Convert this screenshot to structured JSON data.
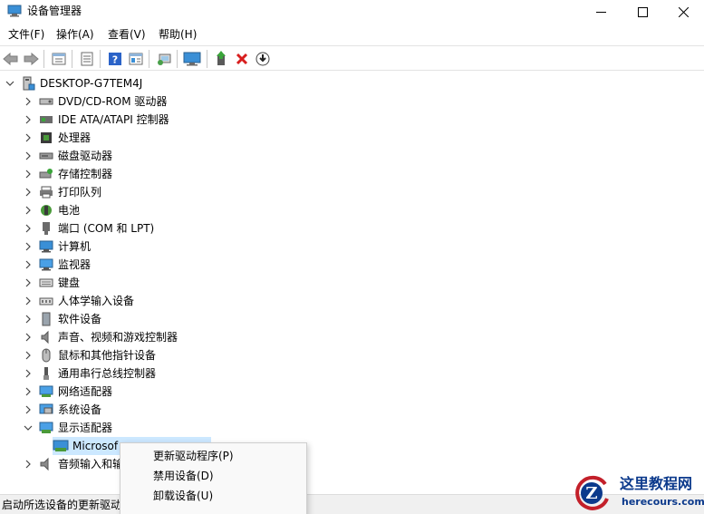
{
  "window": {
    "title": "设备管理器",
    "buttons": {
      "minimize": "minimize-icon",
      "maximize": "maximize-icon",
      "close": "close-icon"
    }
  },
  "menu": [
    "文件(F)",
    "操作(A)",
    "查看(V)",
    "帮助(H)"
  ],
  "toolbar": [
    "back-arrow-icon",
    "forward-arrow-icon",
    "properties-icon",
    "show-hide-icon",
    "help-icon",
    "view-icon",
    "scan-hardware-icon",
    "computer-monitor-icon",
    "update-driver-icon",
    "uninstall-icon",
    "download-icon"
  ],
  "tree": {
    "root": "DESKTOP-G7TEM4J",
    "categories": [
      {
        "label": "DVD/CD-ROM 驱动器",
        "icon": "dvd-drive-icon"
      },
      {
        "label": "IDE ATA/ATAPI 控制器",
        "icon": "ide-controller-icon"
      },
      {
        "label": "处理器",
        "icon": "processor-icon"
      },
      {
        "label": "磁盘驱动器",
        "icon": "disk-drive-icon"
      },
      {
        "label": "存储控制器",
        "icon": "storage-controller-icon"
      },
      {
        "label": "打印队列",
        "icon": "printer-icon"
      },
      {
        "label": "电池",
        "icon": "battery-icon"
      },
      {
        "label": "端口 (COM 和 LPT)",
        "icon": "port-icon"
      },
      {
        "label": "计算机",
        "icon": "computer-icon"
      },
      {
        "label": "监视器",
        "icon": "monitor-icon"
      },
      {
        "label": "键盘",
        "icon": "keyboard-icon"
      },
      {
        "label": "人体学输入设备",
        "icon": "hid-icon"
      },
      {
        "label": "软件设备",
        "icon": "software-device-icon"
      },
      {
        "label": "声音、视频和游戏控制器",
        "icon": "sound-icon"
      },
      {
        "label": "鼠标和其他指针设备",
        "icon": "mouse-icon"
      },
      {
        "label": "通用串行总线控制器",
        "icon": "usb-icon"
      },
      {
        "label": "网络适配器",
        "icon": "network-adapter-icon"
      },
      {
        "label": "系统设备",
        "icon": "system-device-icon"
      },
      {
        "label": "显示适配器",
        "icon": "display-adapter-icon"
      }
    ],
    "child": "Microsof",
    "last_category": "音频输入和输"
  },
  "context_menu": [
    "更新驱动程序(P)",
    "禁用设备(D)",
    "卸载设备(U)"
  ],
  "status": "启动所选设备的更新驱动",
  "watermark": {
    "cn": "这里教程网",
    "en": "herecours.com"
  },
  "colors": {
    "selection": "#cce8ff",
    "uninstall_red": "#d81e1e",
    "watermark_blue": "#0c3a8c"
  }
}
